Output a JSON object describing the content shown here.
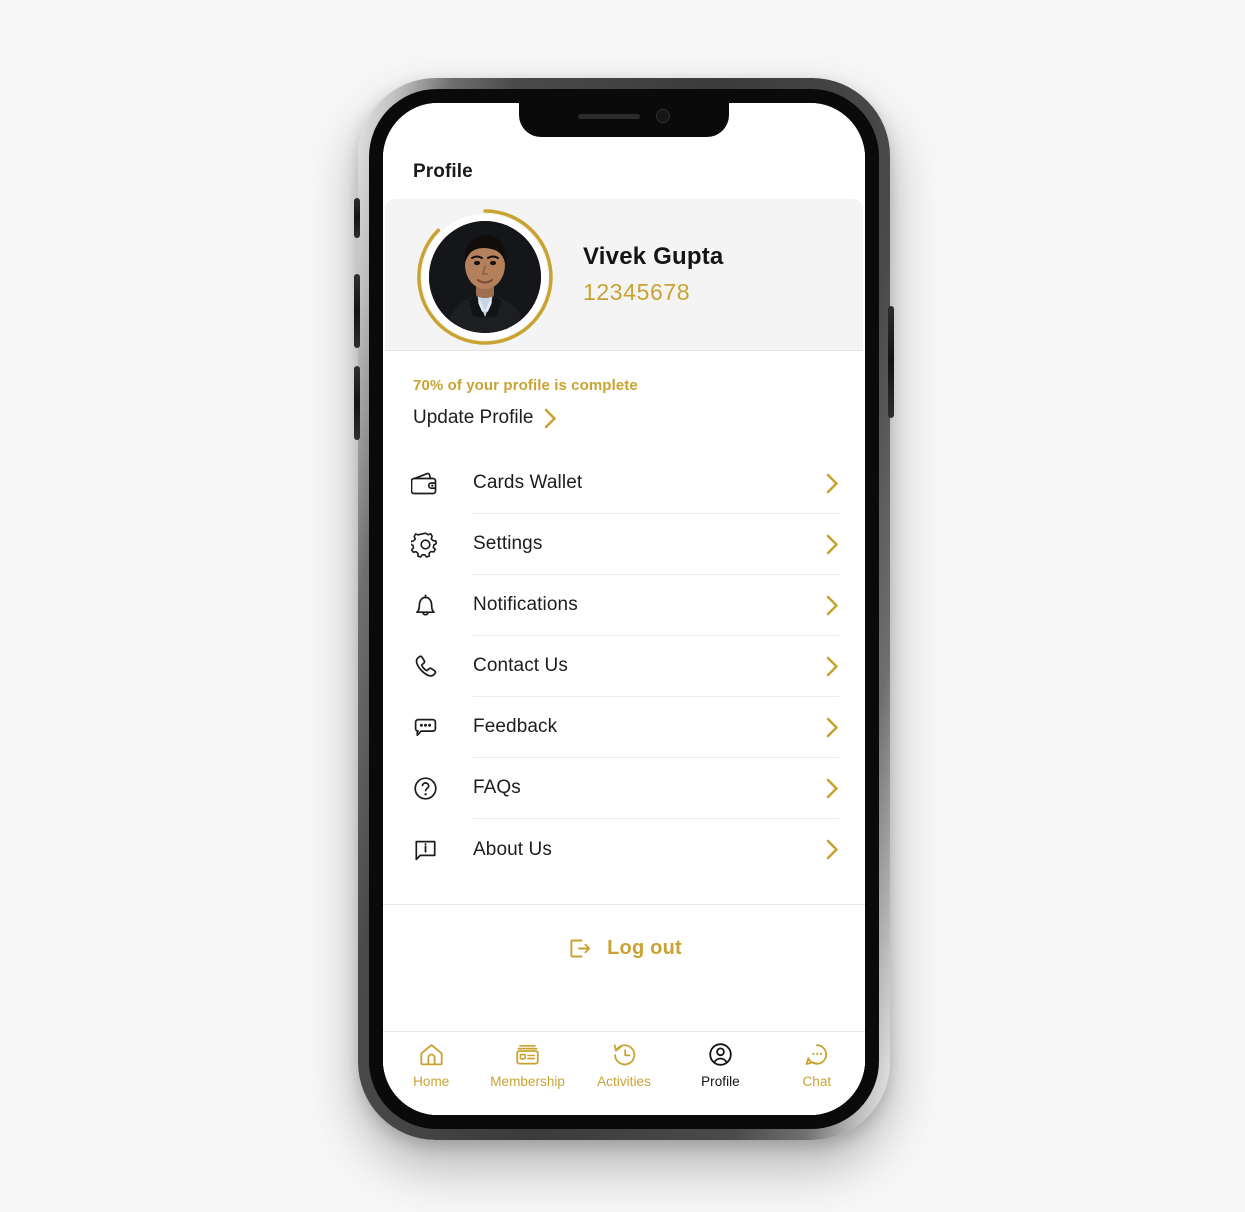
{
  "app": {
    "screen_title": "Profile",
    "accent_color": "#c9a332",
    "text_color": "#1d1d1d",
    "card_bg": "#f4f4f4"
  },
  "profile": {
    "name": "Vivek Gupta",
    "member_id": "12345678",
    "completion_text": "70% of your profile is complete",
    "completion_percent": 70,
    "update_label": "Update Profile",
    "update_chevron_icon": "chevron-right-icon",
    "avatar_icon": "user-photo"
  },
  "menu": {
    "items": [
      {
        "label": "Cards Wallet",
        "icon": "wallet-icon",
        "chevron": "chevron-right-icon"
      },
      {
        "label": "Settings",
        "icon": "gear-icon",
        "chevron": "chevron-right-icon"
      },
      {
        "label": "Notifications",
        "icon": "bell-icon",
        "chevron": "chevron-right-icon"
      },
      {
        "label": "Contact Us",
        "icon": "phone-icon",
        "chevron": "chevron-right-icon"
      },
      {
        "label": "Feedback",
        "icon": "chat-dots-icon",
        "chevron": "chevron-right-icon"
      },
      {
        "label": "FAQs",
        "icon": "question-mark-icon",
        "chevron": "chevron-right-icon"
      },
      {
        "label": "About Us",
        "icon": "info-bubble-icon",
        "chevron": "chevron-right-icon"
      }
    ]
  },
  "logout": {
    "label": "Log out",
    "icon": "logout-icon"
  },
  "tabbar": {
    "tabs": [
      {
        "label": "Home",
        "icon": "home-icon",
        "active": false
      },
      {
        "label": "Membership",
        "icon": "card-icon",
        "active": false
      },
      {
        "label": "Activities",
        "icon": "history-icon",
        "active": false
      },
      {
        "label": "Profile",
        "icon": "person-icon",
        "active": true
      },
      {
        "label": "Chat",
        "icon": "chat-icon",
        "active": false
      }
    ]
  },
  "device": {
    "notch_speaker": "earpiece-speaker",
    "notch_camera": "front-camera"
  }
}
